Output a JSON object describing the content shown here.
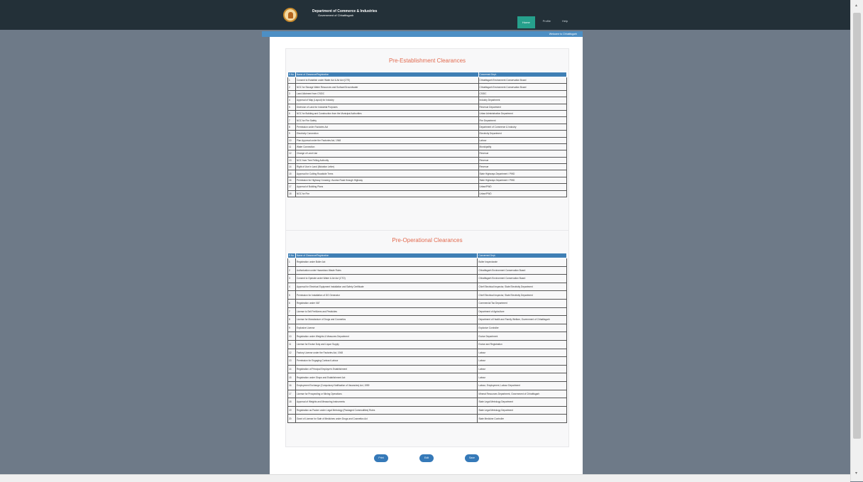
{
  "header": {
    "org_line1": "Department of Commerce & Industries",
    "org_line2": "Government of Chhattisgarh",
    "nav": [
      {
        "label": "Home"
      },
      {
        "label": "Profile"
      },
      {
        "label": "Help"
      }
    ]
  },
  "breadcrumb": "Welcome to Chhattisgarh",
  "sections": [
    {
      "title": "Pre-Establishment Clearances",
      "columns": [
        "S.No",
        "Name of Clearance/Registration",
        "Concerned Dept."
      ],
      "rows": [
        [
          "1",
          "Consent to Establish under Water Act & Air Act (CTE)",
          "Chhattisgarh Environment Conservation Board"
        ],
        [
          "2",
          "NOC for Storage Water Resources and Surface/Groundwater",
          "Chhattisgarh Environment Conservation Board"
        ],
        [
          "3",
          "Land Allotment from CSIDC",
          "CSIDC"
        ],
        [
          "4",
          "Approval of Map (Layout) for Industry",
          "Industry Department"
        ],
        [
          "5",
          "Diversion of Land for Industrial Purposes",
          "Revenue Department"
        ],
        [
          "6",
          "NOC for Building and Construction from the Municipal Authorities",
          "Urban Administration Department"
        ],
        [
          "7",
          "NOC for Fire Safety",
          "Fire Department"
        ],
        [
          "8",
          "Permission under Factories Act",
          "Department of Commerce & Industry"
        ],
        [
          "9",
          "Electricity Connection",
          "Electricity Department"
        ],
        [
          "10",
          "Plan Approval under the Factories Act, 1948",
          "Labour"
        ],
        [
          "11",
          "Water Connection",
          "Municipality"
        ],
        [
          "12",
          "Change of Land Use",
          "Revenue"
        ],
        [
          "13",
          "NOC from Tree Felling Authority",
          "Revenue"
        ],
        [
          "14",
          "Right of Use in Land (Mutation Letter)",
          "Revenue"
        ],
        [
          "15",
          "Approval for Cutting Roadside Trees",
          "State Highways Department / PWD"
        ],
        [
          "16",
          "Permission for Highway Crossing / Access Road through Highway",
          "State Highways Department / PWD"
        ],
        [
          "17",
          "Approval of Building Plans",
          "Urban/PWD"
        ],
        [
          "18",
          "NOC for Fire",
          "Urban/PWD"
        ]
      ]
    },
    {
      "title": "Pre-Operational Clearances",
      "columns": [
        "S.No",
        "Name of Clearance/Registration",
        "Concerned Dept."
      ],
      "rows": [
        [
          "1",
          "Registration under Boiler Act",
          "Boiler Inspectorate"
        ],
        [
          "2",
          "Authorization under Hazardous Waste Rules",
          "Chhattisgarh Environment Conservation Board"
        ],
        [
          "3",
          "Consent to Operate under Water & Air Act (CTO)",
          "Chhattisgarh Environment Conservation Board"
        ],
        [
          "4",
          "Approval for Electrical Equipment Installation and Safety Certificate",
          "Chief Electrical Inspector, State Electricity Department"
        ],
        [
          "5",
          "Permission for Installation of DG Generator",
          "Chief Electrical Inspector, State Electricity Department"
        ],
        [
          "6",
          "Registration under VAT",
          "Commercial Tax Department"
        ],
        [
          "7",
          "License to Sell Fertilizers and Pesticides",
          "Department of Agriculture"
        ],
        [
          "8",
          "License for Manufacture of Drugs and Cosmetics",
          "Department of Health and Family Welfare, Government of Chhattisgarh"
        ],
        [
          "9",
          "Explosive License",
          "Explosive Controller"
        ],
        [
          "10",
          "Registration under Weights & Measures Department",
          "Excise Department"
        ],
        [
          "11",
          "License for Excise Duty and Liquor Supply",
          "Excise and Registration"
        ],
        [
          "12",
          "Factory License under the Factories Act, 1948",
          "Labour"
        ],
        [
          "13",
          "Permission for Engaging Contract Labour",
          "Labour"
        ],
        [
          "14",
          "Registration of Principal Employer's Establishment",
          "Labour"
        ],
        [
          "15",
          "Registration under Shops and Establishment Act",
          "Labour"
        ],
        [
          "16",
          "Employment Exchange (Compulsory Notification of Vacancies) Act, 1959",
          "Labour, Employment, Labour Department"
        ],
        [
          "17",
          "License for Prospecting or Mining Operations",
          "Mineral Resources Department, Government of Chhattisgarh"
        ],
        [
          "18",
          "Approval of Weights and Measuring Instruments",
          "State Legal Metrology Department"
        ],
        [
          "19",
          "Registration as Packer under Legal Metrology (Packaged Commodities) Rules",
          "State Legal Metrology Department"
        ],
        [
          "20",
          "Grant of License for Sale of Medicines under Drugs and Cosmetics Act",
          "State Medicine Controller"
        ]
      ]
    }
  ],
  "buttons": [
    {
      "label": "Print"
    },
    {
      "label": "Edit"
    },
    {
      "label": "Save"
    }
  ]
}
